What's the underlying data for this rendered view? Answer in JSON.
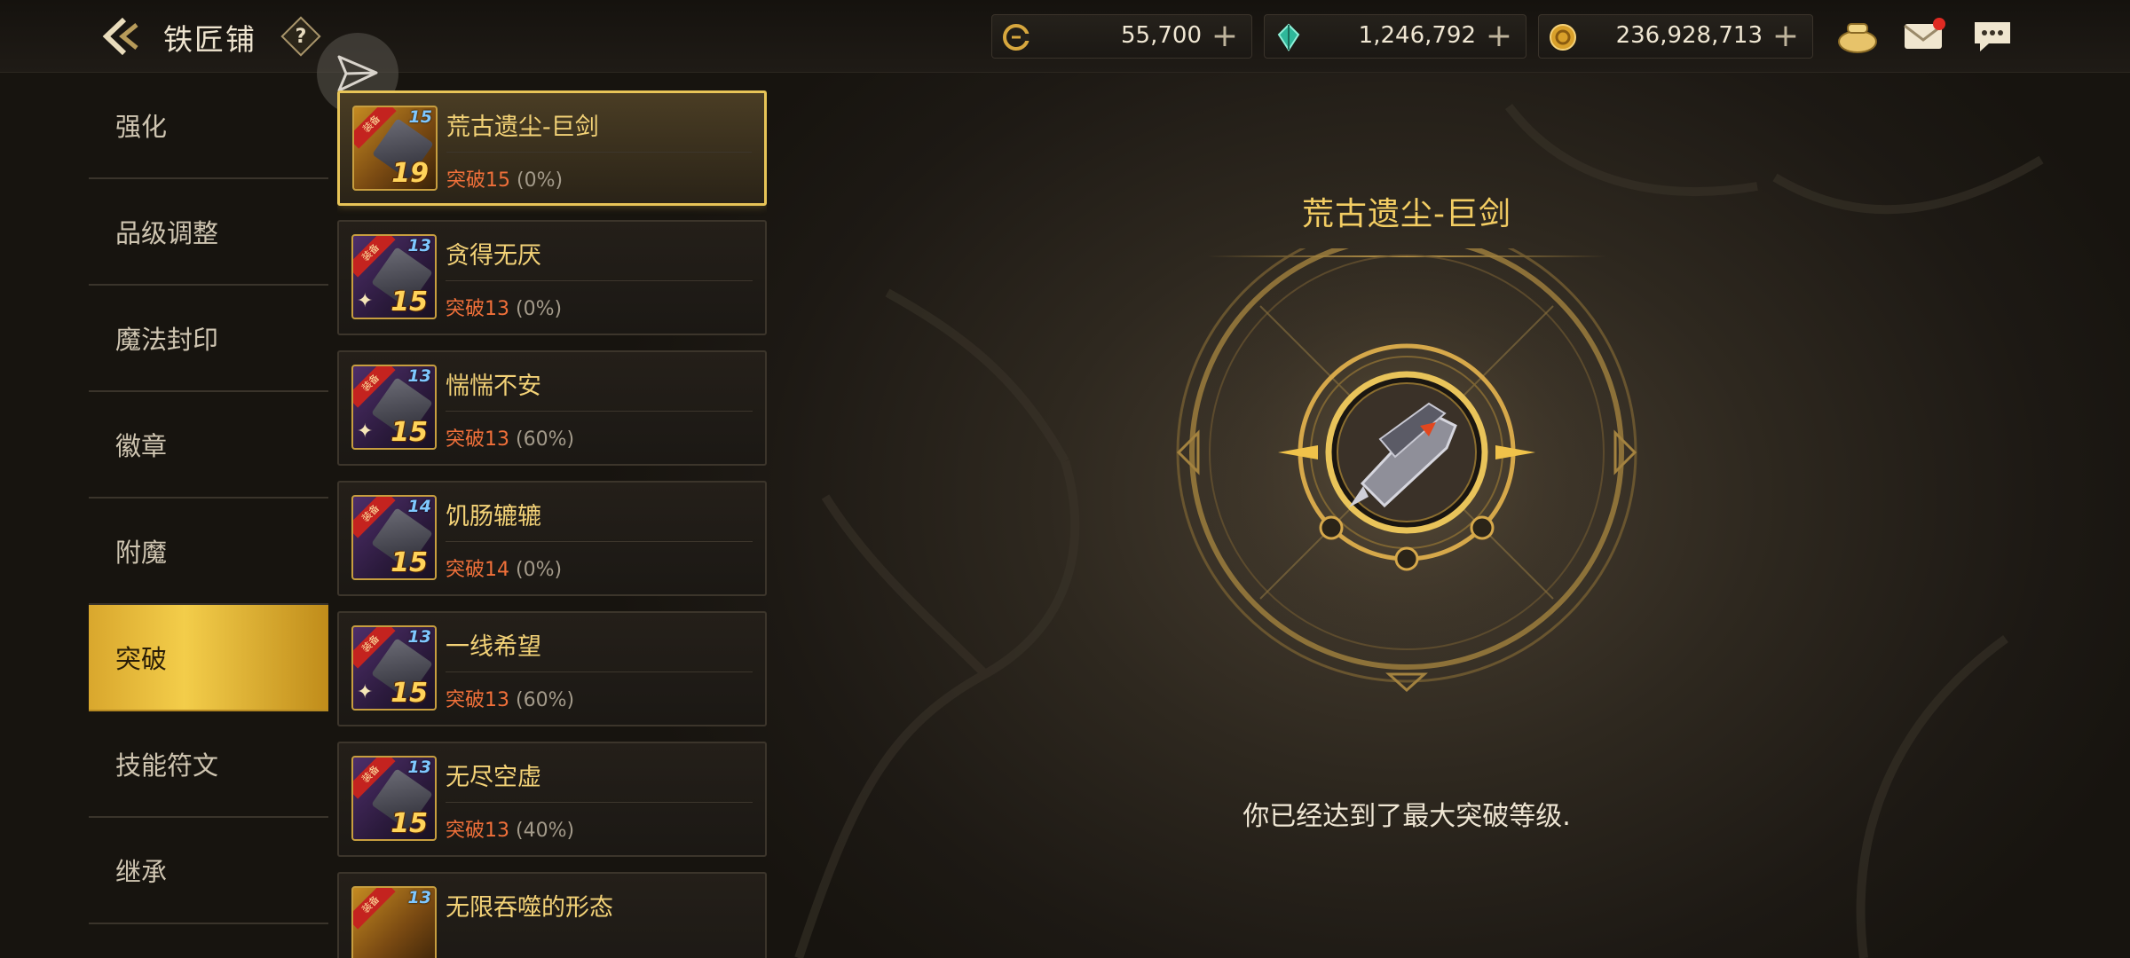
{
  "header": {
    "title": "铁匠铺",
    "help_label": "?",
    "currencies": [
      {
        "icon": "coin-c-icon",
        "value": "55,700",
        "plus": "+"
      },
      {
        "icon": "green-crystal-icon",
        "value": "1,246,792",
        "plus": "+"
      },
      {
        "icon": "gold-coin-icon",
        "value": "236,928,713",
        "plus": "+"
      }
    ]
  },
  "sidebar": {
    "items": [
      {
        "label": "强化",
        "active": false
      },
      {
        "label": "品级调整",
        "active": false
      },
      {
        "label": "魔法封印",
        "active": false
      },
      {
        "label": "徽章",
        "active": false
      },
      {
        "label": "附魔",
        "active": false
      },
      {
        "label": "突破",
        "active": true
      },
      {
        "label": "技能符文",
        "active": false
      },
      {
        "label": "继承",
        "active": false
      }
    ]
  },
  "list": {
    "items": [
      {
        "name": "荒古遗尘-巨剑",
        "breakthrough": "突破15",
        "progress": "(0%)",
        "level_top": "15",
        "level": "19",
        "selected": true,
        "rarity": "gold",
        "tag": "装备"
      },
      {
        "name": "贪得无厌",
        "breakthrough": "突破13",
        "progress": "(0%)",
        "level_top": "13",
        "level": "15",
        "selected": false,
        "rarity": "purple",
        "tag": "装备"
      },
      {
        "name": "惴惴不安",
        "breakthrough": "突破13",
        "progress": "(60%)",
        "level_top": "13",
        "level": "15",
        "selected": false,
        "rarity": "purple",
        "tag": "装备"
      },
      {
        "name": "饥肠辘辘",
        "breakthrough": "突破14",
        "progress": "(0%)",
        "level_top": "14",
        "level": "15",
        "selected": false,
        "rarity": "purple",
        "tag": "装备"
      },
      {
        "name": "一线希望",
        "breakthrough": "突破13",
        "progress": "(60%)",
        "level_top": "13",
        "level": "15",
        "selected": false,
        "rarity": "purple",
        "tag": "装备"
      },
      {
        "name": "无尽空虚",
        "breakthrough": "突破13",
        "progress": "(40%)",
        "level_top": "13",
        "level": "15",
        "selected": false,
        "rarity": "purple",
        "tag": "装备"
      },
      {
        "name": "无限吞噬的形态",
        "breakthrough": "",
        "progress": "",
        "level_top": "13",
        "level": "",
        "selected": false,
        "rarity": "gold",
        "tag": "装备"
      }
    ]
  },
  "detail": {
    "title": "荒古遗尘-巨剑",
    "message": "你已经达到了最大突破等级."
  },
  "colors": {
    "accent_gold": "#f3cd63",
    "active_tab": "#f0c640",
    "breakthrough_text": "#f0703a",
    "notification_dot": "#e02a22"
  }
}
